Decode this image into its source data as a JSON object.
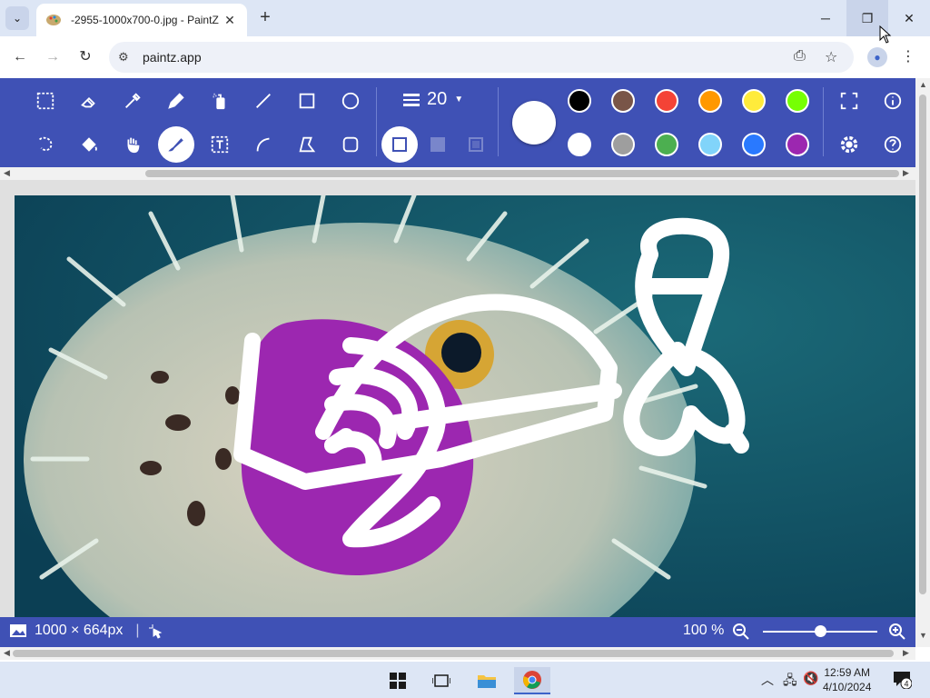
{
  "browser": {
    "tab_title": "-2955-1000x700-0.jpg - PaintZ",
    "tab_close": "✕",
    "new_tab": "+",
    "url": "paintz.app",
    "minimize": "─",
    "restore": "❐",
    "close": "✕"
  },
  "paintz": {
    "tools_row1": [
      "rectangle-select-icon",
      "eraser-icon",
      "eyedropper-icon",
      "pencil-icon",
      "spray-icon",
      "line-icon",
      "rectangle-icon",
      "ellipse-icon"
    ],
    "tools_row2": [
      "freeform-select-icon",
      "fill-bucket-icon",
      "pan-hand-icon",
      "paintbrush-icon",
      "text-icon",
      "curve-icon",
      "polygon-icon",
      "rounded-rectangle-icon"
    ],
    "active_tool": "paintbrush",
    "line_width": "20",
    "colors": {
      "row1": [
        "#000000",
        "#795548",
        "#f44336",
        "#ff9800",
        "#ffeb3b",
        "#76ff03"
      ],
      "row2": [
        "#ffffff",
        "#9e9e9e",
        "#4caf50",
        "#81d4fa",
        "#2979ff",
        "#9c27b0"
      ],
      "current": "#ffffff"
    },
    "right_icons": [
      "fullscreen-icon",
      "info-icon",
      "settings-icon",
      "help-icon"
    ]
  },
  "status": {
    "dimensions": "1000 × 664px",
    "zoom": "100 %"
  },
  "taskbar": {
    "time": "12:59 AM",
    "date": "4/10/2024",
    "notification_count": "4"
  }
}
